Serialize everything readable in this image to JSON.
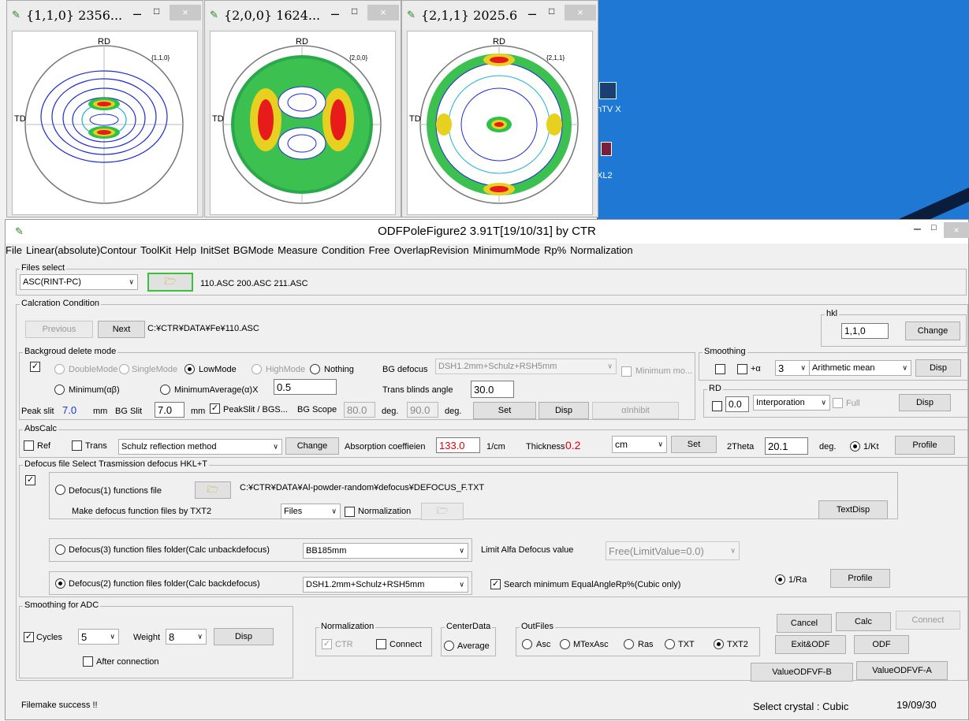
{
  "pole_windows": [
    {
      "title": "{1,1,0} 2356...",
      "label": "{1,1,0}"
    },
    {
      "title": "{2,0,0} 1624...",
      "label": "{2,0,0}"
    },
    {
      "title": "{2,1,1} 2025.6",
      "label": "{2,1,1}"
    }
  ],
  "plot_axes": {
    "rd": "RD",
    "td": "TD"
  },
  "window_buttons": {
    "minimize": "–",
    "maximize": "□",
    "close": "×"
  },
  "desktop": {
    "icon1_label": "nTV X",
    "icon2_label": "XL2"
  },
  "app": {
    "title": "ODFPoleFigure2 3.91T[19/10/31] by CTR"
  },
  "menu": [
    "File",
    "Linear(absolute)Contour",
    "ToolKit",
    "Help",
    "InitSet",
    "BGMode",
    "Measure",
    "Condition",
    "Free",
    "OverlapRevision",
    "MinimumMode",
    "Rp%",
    "Normalization"
  ],
  "files_select": {
    "legend": "Files select",
    "format": "ASC(RINT-PC)",
    "files": "110.ASC 200.ASC 211.ASC"
  },
  "calc": {
    "legend": "Calcration Condition",
    "previous": "Previous",
    "next": "Next",
    "path": "C:¥CTR¥DATA¥Fe¥110.ASC"
  },
  "hkl": {
    "legend": "hkl",
    "value": "1,1,0",
    "change": "Change"
  },
  "bg": {
    "legend": "Backgroud delete mode",
    "double_mode": "DoubleMode",
    "single_mode": "SingleMode",
    "low_mode": "LowMode",
    "high_mode": "HighMode",
    "nothing": "Nothing",
    "bg_defocus_label": "BG defocus",
    "bg_defocus_value": "DSH1.2mm+Schulz+RSH5mm",
    "minimum_mo": "Minimum mo...",
    "minimum_ab": "Minimum(αβ)",
    "minimum_average": "MinimumAverage(α)X",
    "min_avg_value": "0.5",
    "trans_blinds_label": "Trans blinds angle",
    "trans_blinds_value": "30.0",
    "peak_slit_label": "Peak slit",
    "peak_slit_value": "7.0",
    "mm1": "mm",
    "bg_slit_label": "BG Slit",
    "bg_slit_value": "7.0",
    "mm2": "mm",
    "peakslit_bgs": "PeakSlit / BGS...",
    "bg_scope_label": "BG Scope",
    "bg_scope_value1": "80.0",
    "deg1": "deg.",
    "bg_scope_value2": "90.0",
    "deg2": "deg.",
    "set": "Set",
    "disp": "Disp",
    "alpha_inhibit": "αInhibit"
  },
  "smoothing": {
    "legend": "Smoothing",
    "plus_alpha": "+α",
    "level": "3",
    "method": "Arithmetic mean",
    "disp": "Disp"
  },
  "rd_box": {
    "legend": "RD",
    "value": "0.0",
    "method": "Interporation",
    "full": "Full",
    "disp": "Disp"
  },
  "abs": {
    "legend": "AbsCalc",
    "ref": "Ref",
    "trans": "Trans",
    "method": "Schulz reflection method",
    "change": "Change",
    "absorption_label": "Absorption coeffieien",
    "absorption_value": "133.0",
    "unit": "1/cm",
    "thickness_label": "Thickness",
    "thickness_value": "0.2",
    "thickness_unit": "cm",
    "set": "Set",
    "two_theta_label": "2Theta",
    "two_theta_value": "20.1",
    "deg": "deg.",
    "one_over_kt": "1/Kt",
    "profile": "Profile"
  },
  "defocus": {
    "legend": "Defocus file Select Trasmission defocus HKL+T",
    "defocus1_label": "Defocus(1) functions file",
    "defocus1_path": "C:¥CTR¥DATA¥Al-powder-random¥defocus¥DEFOCUS_F.TXT",
    "make_label": "Make defocus function files by TXT2",
    "files_select": "Files",
    "normalization": "Normalization",
    "textdisp": "TextDisp",
    "defocus3_label": "Defocus(3) function files folder(Calc unbackdefocus)",
    "defocus3_value": "BB185mm",
    "limit_label": "Limit Alfa Defocus value",
    "limit_value": "Free(LimitValue=0.0)",
    "defocus2_label": "Defocus(2) function files folder(Calc backdefocus)",
    "defocus2_value": "DSH1.2mm+Schulz+RSH5mm",
    "search_min": "Search minimum EqualAngleRp%(Cubic only)",
    "one_over_ra": "1/Ra",
    "profile": "Profile"
  },
  "adc": {
    "legend": "Smoothing for ADC",
    "cycles_label": "Cycles",
    "cycles_value": "5",
    "weight_label": "Weight",
    "weight_value": "8",
    "disp": "Disp",
    "after_connection": "After connection"
  },
  "norm": {
    "legend": "Normalization",
    "ctr": "CTR",
    "connect": "Connect"
  },
  "center": {
    "legend": "CenterData",
    "average": "Average"
  },
  "outfiles": {
    "legend": "OutFiles",
    "asc": "Asc",
    "mtexasc": "MTexAsc",
    "ras": "Ras",
    "txt": "TXT",
    "txt2": "TXT2"
  },
  "actions": {
    "cancel": "Cancel",
    "calc": "Calc",
    "connect": "Connect",
    "exit_odf": "Exit&ODF",
    "odf": "ODF",
    "value_b": "ValueODFVF-B",
    "value_a": "ValueODFVF-A"
  },
  "status": {
    "message": "Filemake success !!",
    "crystal": "Select crystal : Cubic",
    "date": "19/09/30"
  }
}
